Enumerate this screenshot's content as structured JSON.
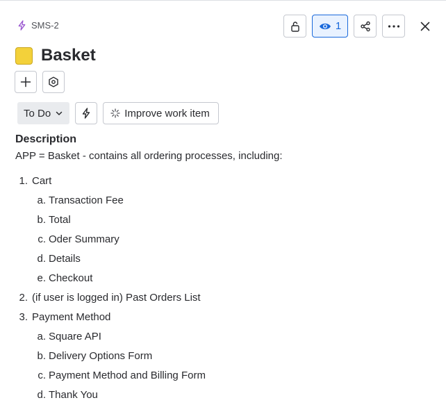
{
  "issue": {
    "key": "SMS-2",
    "title": "Basket",
    "type_color": "#f3d13a"
  },
  "actions": {
    "watch_count": "1"
  },
  "status": {
    "label": "To Do"
  },
  "improve": {
    "label": "Improve work item"
  },
  "description": {
    "heading": "Description",
    "intro": "APP = Basket - contains all ordering processes, including:",
    "items": [
      {
        "marker": "1.",
        "text": "Cart",
        "children": [
          {
            "marker": "a.",
            "text": "Transaction Fee"
          },
          {
            "marker": "b.",
            "text": "Total"
          },
          {
            "marker": "c.",
            "text": "Oder Summary"
          },
          {
            "marker": "d.",
            "text": "Details"
          },
          {
            "marker": "e.",
            "text": "Checkout"
          }
        ]
      },
      {
        "marker": "2.",
        "text": "(if user is logged in) Past Orders List",
        "children": []
      },
      {
        "marker": "3.",
        "text": "Payment Method",
        "children": [
          {
            "marker": "a.",
            "text": "Square API"
          },
          {
            "marker": "b.",
            "text": "Delivery Options Form"
          },
          {
            "marker": "c.",
            "text": "Payment Method and Billing Form"
          },
          {
            "marker": "d.",
            "text": "Thank You"
          }
        ]
      }
    ]
  },
  "colors": {
    "accent": "#1868db",
    "text": "#292a2e"
  }
}
